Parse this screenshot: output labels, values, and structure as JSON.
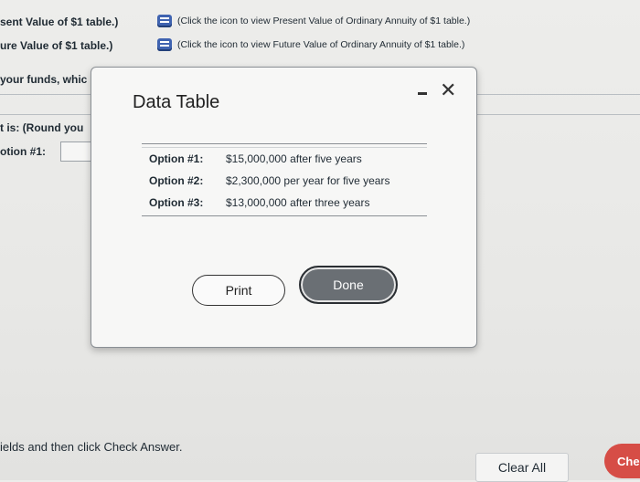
{
  "background": {
    "left_labels": [
      "sent Value of $1 table.)",
      "ure Value of $1 table.)"
    ],
    "references": [
      "(Click the icon to view Present Value of Ordinary Annuity of $1 table.)",
      "(Click the icon to view Future Value of Ordinary Annuity of $1 table.)"
    ],
    "question_fragment": "your funds, whic",
    "round_fragment": "t is: (Round you",
    "option_fragment": "otion #1:",
    "instruction": "ields and then click Check Answer.",
    "clear_all": "Clear All",
    "check_answer": "Che"
  },
  "modal": {
    "title": "Data Table",
    "minimize_icon": "minimize-icon",
    "close_symbol": "✕",
    "rows": [
      {
        "label": "Option #1:",
        "value": "$15,000,000 after five years"
      },
      {
        "label": "Option #2:",
        "value": "$2,300,000 per year for five years"
      },
      {
        "label": "Option #3:",
        "value": "$13,000,000 after three years"
      }
    ],
    "print_label": "Print",
    "done_label": "Done"
  },
  "colors": {
    "accent_red": "#d64d46",
    "icon_blue": "#3f63b0"
  }
}
